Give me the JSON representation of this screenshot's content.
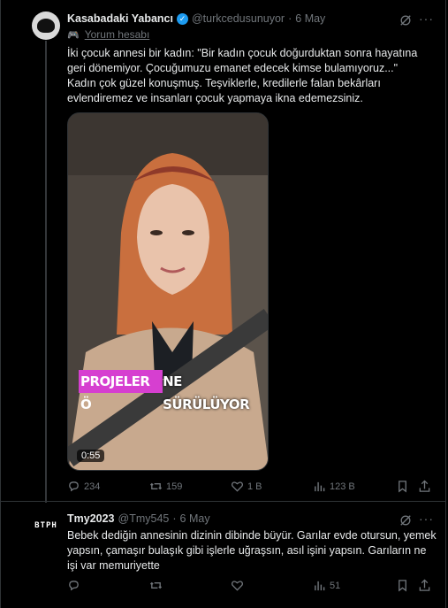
{
  "tweet1": {
    "name": "Kasabadaki Yabancı",
    "handle": "@turkcedusunuyor",
    "dot": "·",
    "date": "6 May",
    "more": "···",
    "tag_icon": "🎮",
    "tag": "Yorum hesabı",
    "lines": [
      "İki çocuk annesi bir kadın: \"Bir kadın çocuk doğurduktan sonra hayatına geri dönemiyor. Çocuğumuzu emanet edecek kimse bulamıyoruz...\"",
      "Kadın çok güzel konuşmuş. Teşviklerle, kredilerle falan bekârları evlendiremez ve insanları çocuk yapmaya ikna edemezsiniz."
    ],
    "video": {
      "caption_pink": "PROJELER Ö",
      "caption_white": "NE SÜRÜLÜYOR",
      "duration": "0:55"
    },
    "stats": {
      "replies": "234",
      "reposts": "159",
      "likes": "1 B",
      "views": "123 B"
    }
  },
  "tweet2": {
    "avatar_text": "ΒΤΡΗ",
    "name": "Tmy2023",
    "handle": "@Tmy545",
    "dot": "·",
    "date": "6 May",
    "more": "···",
    "text": "Bebek dediğin annesinin dizinin dibinde büyür. Garılar evde otursun, yemek yapsın, çamaşır bulaşık gibi işlerle uğraşsın, asıl işini yapsın. Garıların ne işi var memuriyette",
    "stats": {
      "views": "51"
    }
  },
  "colors": {
    "background": "#000000",
    "text": "#e7e9ea",
    "muted": "#71767b",
    "verified": "#1d9bf0",
    "caption": "#d63fd0"
  }
}
